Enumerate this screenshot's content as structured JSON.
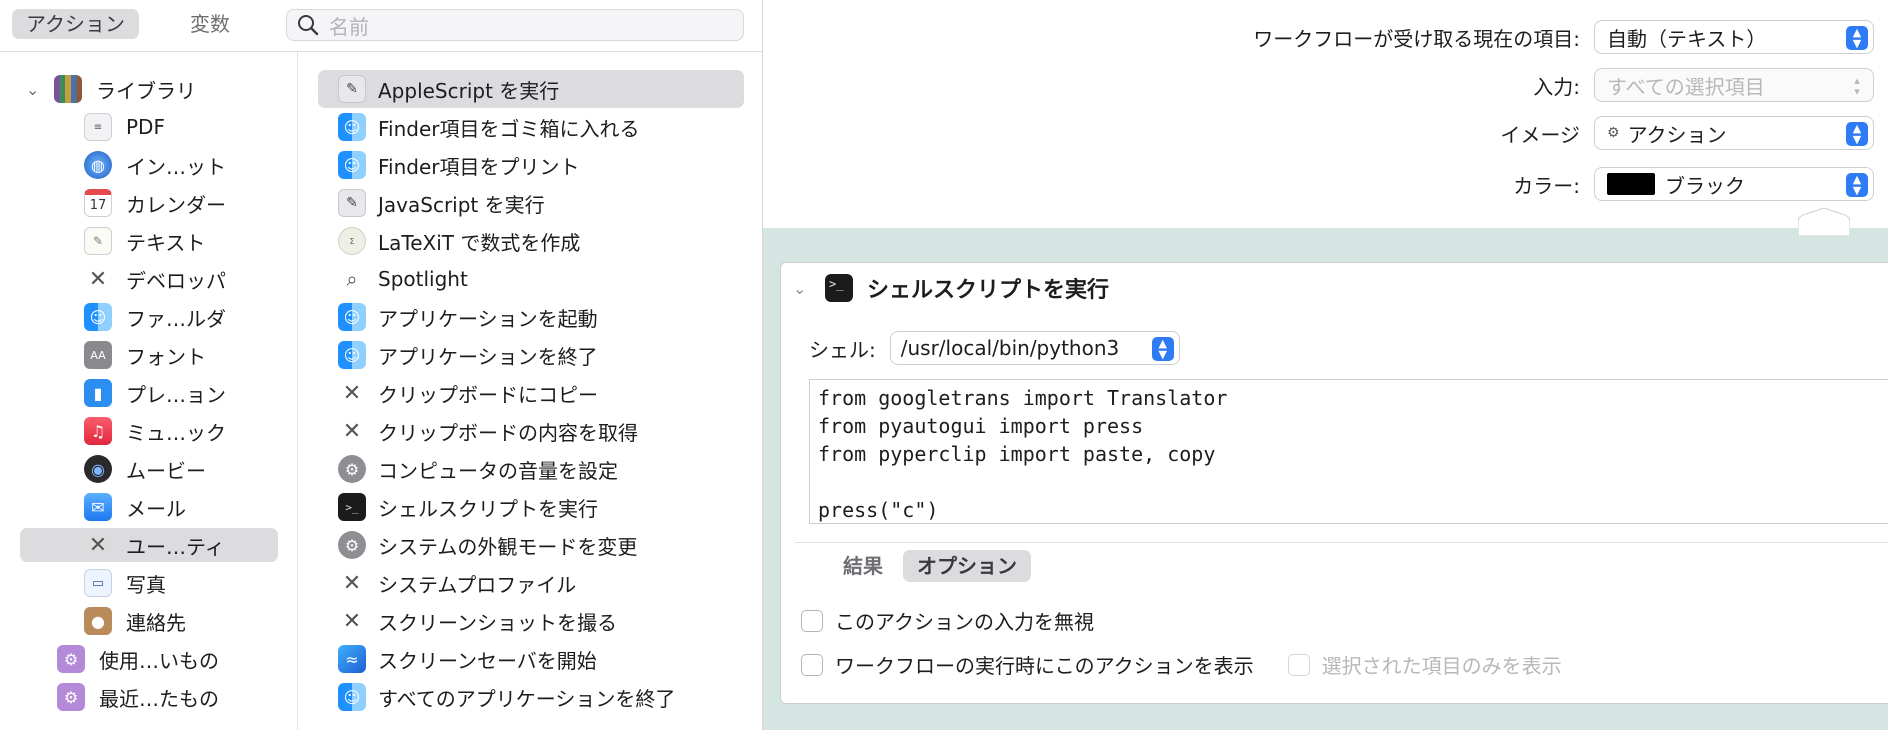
{
  "left_pane": {
    "segmented": {
      "actions_label": "アクション",
      "variables_label": "変数"
    },
    "search": {
      "placeholder": "名前"
    },
    "library": {
      "root_label": "ライブラリ",
      "items": [
        {
          "label": "PDF",
          "icon": "pdf-icon"
        },
        {
          "label": "イン…ット",
          "icon": "internet-icon"
        },
        {
          "label": "カレンダー",
          "icon": "calendar-icon",
          "icon_text": "17"
        },
        {
          "label": "テキスト",
          "icon": "text-icon"
        },
        {
          "label": "デベロッパ",
          "icon": "developer-tools-icon"
        },
        {
          "label": "ファ…ルダ",
          "icon": "finder-icon"
        },
        {
          "label": "フォント",
          "icon": "font-icon",
          "icon_text": "AA"
        },
        {
          "label": "プレ…ョン",
          "icon": "presentation-icon"
        },
        {
          "label": "ミュ…ック",
          "icon": "music-icon"
        },
        {
          "label": "ムービー",
          "icon": "movie-icon"
        },
        {
          "label": "メール",
          "icon": "mail-icon"
        },
        {
          "label": "ユー…ティ",
          "icon": "utilities-icon"
        },
        {
          "label": "写真",
          "icon": "photos-icon"
        },
        {
          "label": "連絡先",
          "icon": "contacts-icon"
        }
      ],
      "folders": [
        {
          "label": "使用…いもの",
          "icon": "smart-folder-icon"
        },
        {
          "label": "最近…たもの",
          "icon": "smart-folder-icon"
        }
      ]
    },
    "actions": [
      {
        "label": "AppleScript を実行",
        "icon": "applescript-icon"
      },
      {
        "label": "Finder項目をゴミ箱に入れる",
        "icon": "finder-icon"
      },
      {
        "label": "Finder項目をプリント",
        "icon": "finder-icon"
      },
      {
        "label": "JavaScript を実行",
        "icon": "script-editor-icon"
      },
      {
        "label": "LaTeXiT で数式を作成",
        "icon": "latexit-icon"
      },
      {
        "label": "Spotlight",
        "icon": "spotlight-icon"
      },
      {
        "label": "アプリケーションを起動",
        "icon": "finder-icon"
      },
      {
        "label": "アプリケーションを終了",
        "icon": "finder-icon"
      },
      {
        "label": "クリップボードにコピー",
        "icon": "utilities-icon"
      },
      {
        "label": "クリップボードの内容を取得",
        "icon": "utilities-icon"
      },
      {
        "label": "コンピュータの音量を設定",
        "icon": "system-preferences-icon"
      },
      {
        "label": "シェルスクリプトを実行",
        "icon": "terminal-icon"
      },
      {
        "label": "システムの外観モードを変更",
        "icon": "system-preferences-icon"
      },
      {
        "label": "システムプロファイル",
        "icon": "utilities-icon"
      },
      {
        "label": "スクリーンショットを撮る",
        "icon": "utilities-icon"
      },
      {
        "label": "スクリーンセーバを開始",
        "icon": "screensaver-icon"
      },
      {
        "label": "すべてのアプリケーションを終了",
        "icon": "finder-icon"
      }
    ]
  },
  "workflow": {
    "receives_label": "ワークフローが受け取る現在の項目:",
    "receives_value": "自動（テキスト）",
    "input_label": "入力:",
    "input_value": "すべての選択項目",
    "image_label": "イメージ",
    "image_value": "アクション",
    "color_label": "カラー:",
    "color_value": "ブラック",
    "color_swatch": "#000000"
  },
  "action_card": {
    "title": "シェルスクリプトを実行",
    "shell_label": "シェル:",
    "shell_value": "/usr/local/bin/python3",
    "code": "from googletrans import Translator\nfrom pyautogui import press\nfrom pyperclip import paste, copy\n\npress(\"c\")",
    "tabs": {
      "results": "結果",
      "options": "オプション"
    },
    "options": {
      "ignore_input": "このアクションの入力を無視",
      "show_when_run": "ワークフローの実行時にこのアクションを表示",
      "show_selected_only": "選択された項目のみを表示"
    }
  },
  "colors": {
    "accent": "#2f7bf6",
    "canvas": "#d5e6e2",
    "selection": "#dcdcde"
  }
}
